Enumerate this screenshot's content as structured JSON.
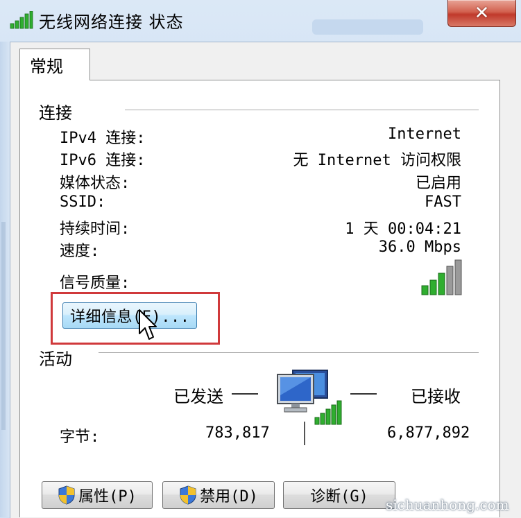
{
  "window": {
    "title": "无线网络连接 状态",
    "close_label": "✕"
  },
  "tabs": [
    {
      "label": "常规"
    }
  ],
  "connection": {
    "group_label": "连接",
    "rows": [
      {
        "label": "IPv4 连接:",
        "value": "Internet"
      },
      {
        "label": "IPv6 连接:",
        "value": "无 Internet 访问权限"
      },
      {
        "label": "媒体状态:",
        "value": "已启用"
      },
      {
        "label": "SSID:",
        "value": "FAST"
      },
      {
        "label": "持续时间:",
        "value": "1 天 00:04:21"
      },
      {
        "label": "速度:",
        "value": "36.0 Mbps"
      }
    ],
    "signal_label": "信号质量:",
    "signal_level": "3 of 5 bars",
    "details_button": "详细信息(E)..."
  },
  "activity": {
    "group_label": "活动",
    "sent_label": "已发送",
    "received_label": "已接收",
    "bytes_label": "字节:",
    "bytes_sent": "783,817",
    "bytes_received": "6,877,892"
  },
  "buttons": {
    "properties": "属性(P)",
    "disable": "禁用(D)",
    "diagnose": "诊断(G)"
  },
  "watermark": "sichuanhong.com",
  "colors": {
    "highlight_border": "#d0393b",
    "signal_green": "#2fae2f",
    "close_red": "#c0392b"
  }
}
